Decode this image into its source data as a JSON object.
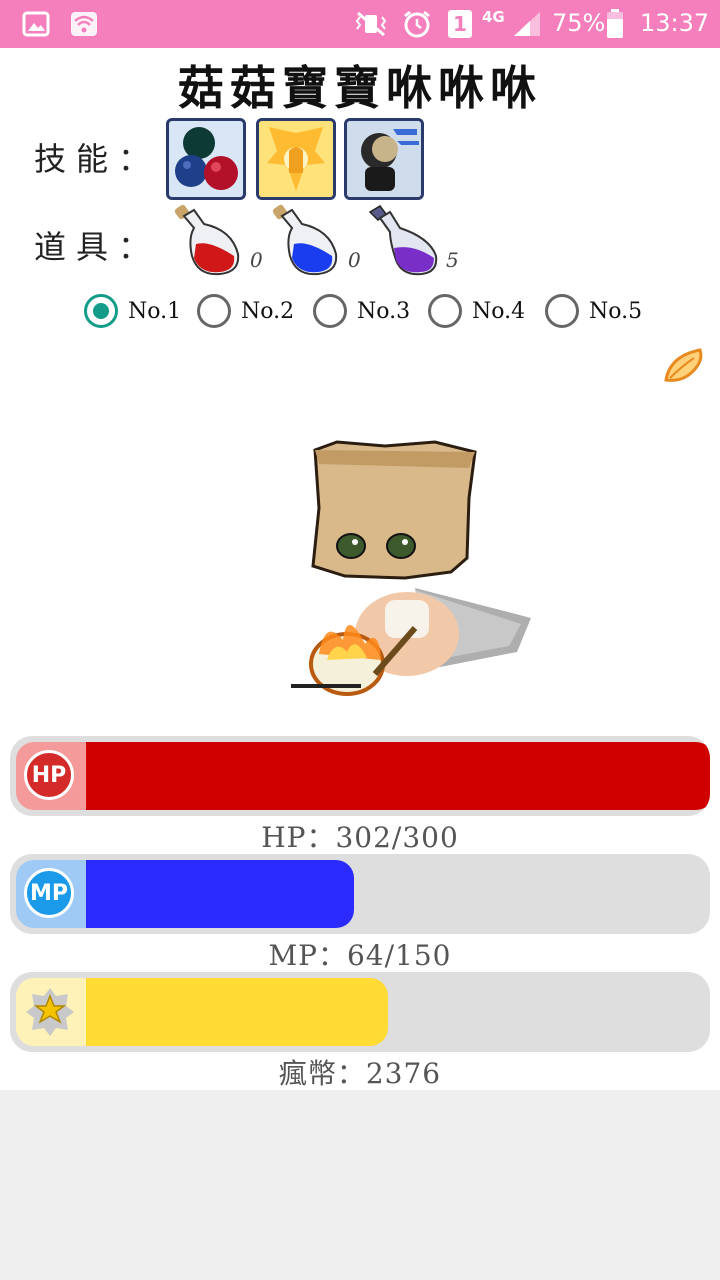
{
  "status_bar": {
    "carrier_slot": "1",
    "network": "4G",
    "battery": "75%",
    "time": "13:37"
  },
  "title": "菇菇寶寶咻咻咻",
  "skills": {
    "label": "技能：",
    "items": [
      {
        "name": "boxing-gloves-skill-icon"
      },
      {
        "name": "golden-wings-skill-icon"
      },
      {
        "name": "dash-skill-icon"
      }
    ]
  },
  "items": {
    "label": "道具：",
    "potions": [
      {
        "name": "red-potion-icon",
        "count": "0",
        "color": "#d01818"
      },
      {
        "name": "blue-potion-icon",
        "count": "0",
        "color": "#1a3df0"
      },
      {
        "name": "elixir-potion-icon",
        "count": "5",
        "color": "#7a2ec8"
      }
    ]
  },
  "slots": {
    "options": [
      "No.1",
      "No.2",
      "No.3",
      "No.4",
      "No.5"
    ],
    "selected": "No.1",
    "accent": "#139c8a"
  },
  "stats": {
    "hp": {
      "badge": "HP",
      "text": "HP：302/300",
      "fraction": 1.0,
      "color": "#d10000",
      "cap_color": "#f59a9a"
    },
    "mp": {
      "badge": "MP",
      "text": "MP：64/150",
      "fraction": 0.427,
      "color": "#2b2bff",
      "cap_color": "#9fcaf5"
    },
    "coin": {
      "text": "瘋幣：2376",
      "color": "#ffdb33",
      "cap_color": "#fff2b8"
    }
  }
}
